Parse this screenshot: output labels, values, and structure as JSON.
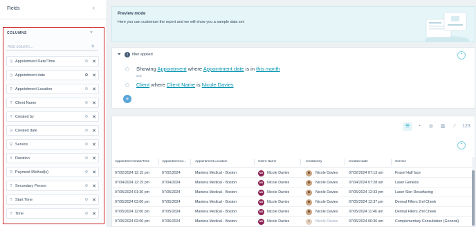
{
  "sidebar": {
    "title": "Fields",
    "collapse_icon": "chevron-left-icon",
    "columns_header": "COLUMNS",
    "search_placeholder": "Add column...",
    "fields": [
      {
        "label": "Appointment Date/Time",
        "type_icon": "calendar-icon"
      },
      {
        "label": "Appointment date",
        "type_icon": "calendar-icon"
      },
      {
        "label": "Appointment Location",
        "type_icon": "search-icon"
      },
      {
        "label": "Client Name",
        "type_icon": "text-icon"
      },
      {
        "label": "Created by",
        "type_icon": "text-icon"
      },
      {
        "label": "Created date",
        "type_icon": "calendar-icon"
      },
      {
        "label": "Service",
        "type_icon": "search-icon"
      },
      {
        "label": "Duration",
        "type_icon": "number-icon"
      },
      {
        "label": "Payment Method(s)",
        "type_icon": "search-icon"
      },
      {
        "label": "Secondary Person",
        "type_icon": "text-icon"
      },
      {
        "label": "Start Time",
        "type_icon": "text-icon"
      },
      {
        "label": "Time",
        "type_icon": "text-icon"
      }
    ]
  },
  "preview": {
    "title": "Preview mode",
    "text": "Here you can customize the report and we will show you a sample data set."
  },
  "filter": {
    "count": "1",
    "label": "filter applied",
    "line1": {
      "showing": "Showing",
      "object": "Appointment",
      "where": "where",
      "field": "Appointment date",
      "is_in": "is in",
      "value": "this month"
    },
    "and_label": "and",
    "line2": {
      "object": "Client",
      "where": "where",
      "field": "Client Name",
      "is": "is",
      "value": "Nicole Davies"
    },
    "add_label": "+"
  },
  "table": {
    "viz_icons": [
      "table-icon",
      "pie-chart-icon",
      "donut-chart-icon",
      "bar-chart-icon",
      "line-chart-icon",
      "number-icon"
    ],
    "viz_number_label": "123",
    "columns": [
      "Appointment Date/Time",
      "Appointment d...",
      "Appointment Location",
      "Client Name",
      "Created by",
      "Created date",
      "Service"
    ],
    "rows": [
      {
        "date_time": "07/02/2024 12:15 pm",
        "date": "07/02/2024",
        "location": "Maniera Medical - Boston",
        "client": "Nicole Davies",
        "client_initials": "ND",
        "created_by": "Nicole Davies",
        "created_date": "07/02/2024 07:13 am",
        "service": "Frasel Half face"
      },
      {
        "date_time": "07/04/2024 12:15 pm",
        "date": "07/04/2024",
        "location": "Maniera Medical - Boston",
        "client": "Nicole Davies",
        "client_initials": "ND",
        "created_by": "Nicole Davies",
        "created_date": "07/04/2024 07:28 am",
        "service": "Laser Genesis"
      },
      {
        "date_time": "07/05/2024 01:30 pm",
        "date": "07/05/2024",
        "location": "Maniera Medical - Boston",
        "client": "Nicole Davies",
        "client_initials": "ND",
        "created_by": "Nicole Davies",
        "created_date": "07/05/2024 12:33 pm",
        "service": "Laser Skin Resurfacing"
      },
      {
        "date_time": "07/05/2024 03:00 pm",
        "date": "07/05/2024",
        "location": "Maniera Medical - Boston",
        "client": "Nicole Davies",
        "client_initials": "ND",
        "created_by": "Nicole Davies",
        "created_date": "07/05/2024 12:37 pm",
        "service": "Dermal Fillers 2ml Cheek"
      },
      {
        "date_time": "07/05/2024 12:00 pm",
        "date": "07/05/2024",
        "location": "Maniera Medical - Boston",
        "client": "Nicole Davies",
        "client_initials": "ND",
        "created_by": "Nicole Davies",
        "created_date": "07/05/2024 11:46 am",
        "service": "Dermal Fillers 2ml Cheek"
      },
      {
        "date_time": "07/06/2024 02:00 pm",
        "date": "07/06/2024",
        "location": "Maniera Medical - Boston",
        "client": "Nicole Davies",
        "client_initials": "ND",
        "created_by": "Nicole Davies",
        "created_date": "07/06/2024 06:36 am",
        "service": "Complementary Consultation (General)"
      }
    ]
  }
}
